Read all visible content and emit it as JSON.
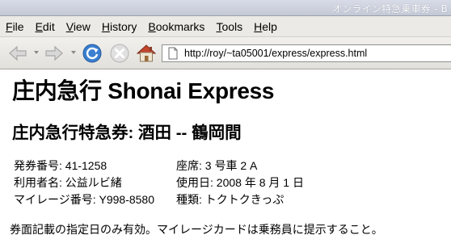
{
  "window": {
    "title": "オンライン特急乗車券 - B"
  },
  "menu": {
    "items": [
      {
        "accel": "F",
        "rest": "ile"
      },
      {
        "accel": "E",
        "rest": "dit"
      },
      {
        "accel": "V",
        "rest": "iew"
      },
      {
        "accel": "H",
        "rest": "istory"
      },
      {
        "accel": "B",
        "rest": "ookmarks"
      },
      {
        "accel": "T",
        "rest": "ools"
      },
      {
        "accel": "H",
        "rest": "elp"
      }
    ]
  },
  "toolbar": {
    "icons": [
      "back-arrow-icon",
      "forward-arrow-icon",
      "reload-icon",
      "stop-icon",
      "home-icon"
    ],
    "url": "http://roy/~ta05001/express/express.html"
  },
  "page": {
    "heading": "庄内急行 Shonai Express",
    "subheading": "庄内急行特急券: 酒田 -- 鶴岡間",
    "ticket_number": "発券番号: 41-1258",
    "seat": "座席: 3 号車 2 A",
    "user_name": "利用者名: 公益ルビ緒",
    "use_date": "使用日: 2008 年 8 月 1 日",
    "mileage_number": "マイレージ番号: Y998-8580",
    "ticket_type": "種類: トクトクきっぷ",
    "notice": "券面記載の指定日のみ有効。マイレージカードは乗務員に提示すること。"
  }
}
